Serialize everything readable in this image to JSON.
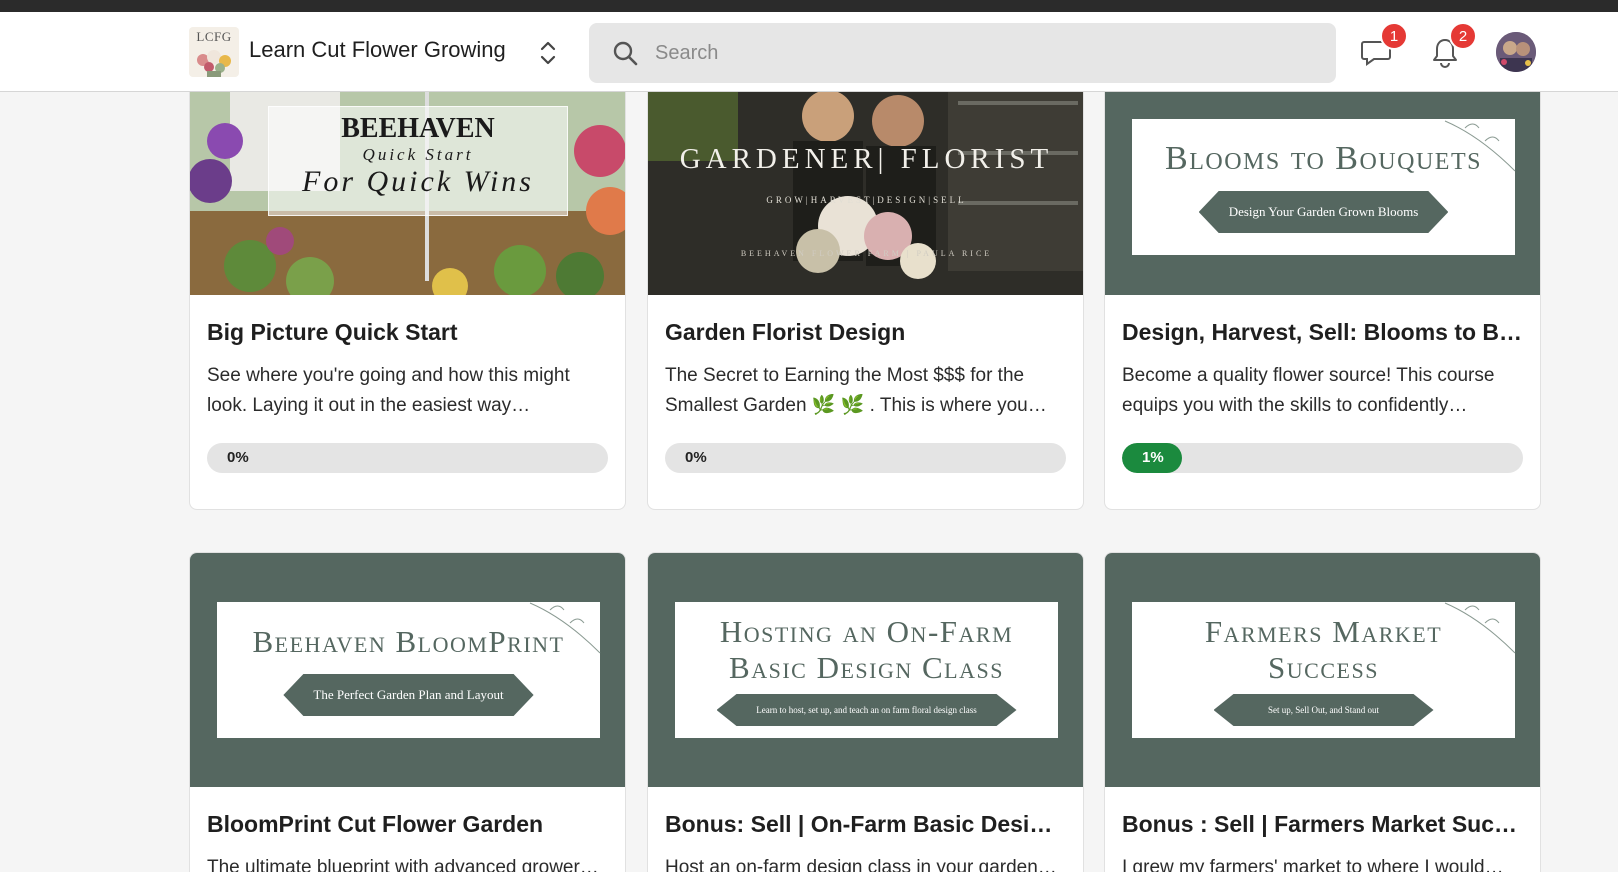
{
  "header": {
    "logo_text": "LCFG",
    "brand": "Learn Cut Flower Growing",
    "search_placeholder": "Search",
    "messages_count": "1",
    "notifications_count": "2"
  },
  "colors": {
    "accent_green": "#1b8a3e",
    "banner_green": "#556760",
    "badge_red": "#e53935"
  },
  "courses": [
    {
      "title": "Big Picture Quick Start",
      "description": "See where you're going and how this might look. Laying it out in the easiest way…",
      "progress_label": "0%",
      "progress_value": 0,
      "thumb": {
        "line1": "BEEHAVEN",
        "line2": "Quick Start",
        "line3": "For Quick Wins"
      }
    },
    {
      "title": "Garden Florist Design",
      "description": "The Secret to Earning the Most $$$ for the Smallest Garden 🌿 🌿 . This is where you…",
      "progress_label": "0%",
      "progress_value": 0,
      "thumb": {
        "line1": "GARDENER| FLORIST",
        "line2": "GROW|HARVEST|DESIGN|SELL",
        "line3": "BEEHAVEN FLOWER FARM | PAULA RICE"
      }
    },
    {
      "title": "Design, Harvest, Sell: Blooms to Bouquets",
      "description": "Become a quality flower source! This course equips you with the skills to confidently…",
      "progress_label": "1%",
      "progress_value": 1,
      "thumb": {
        "line1": "Blooms to Bouquets",
        "ribbon": "Design Your Garden Grown Blooms"
      }
    },
    {
      "title": "BloomPrint Cut Flower Garden",
      "description": "The ultimate blueprint with advanced grower…",
      "thumb": {
        "line1": "Beehaven BloomPrint",
        "ribbon": "The Perfect Garden Plan and Layout"
      }
    },
    {
      "title": "Bonus: Sell | On-Farm Basic Design Class",
      "description": "Host an on-farm design class in your garden…",
      "thumb": {
        "line1": "Hosting an On-Farm",
        "line2": "Basic Design Class",
        "ribbon": "Learn to host, set up, and teach an on farm floral design class"
      }
    },
    {
      "title": "Bonus : Sell | Farmers Market Success",
      "description": "I grew my farmers' market to where I would…",
      "thumb": {
        "line1": "Farmers Market",
        "line2": "Success",
        "ribbon": "Set up, Sell Out, and Stand out"
      }
    }
  ]
}
